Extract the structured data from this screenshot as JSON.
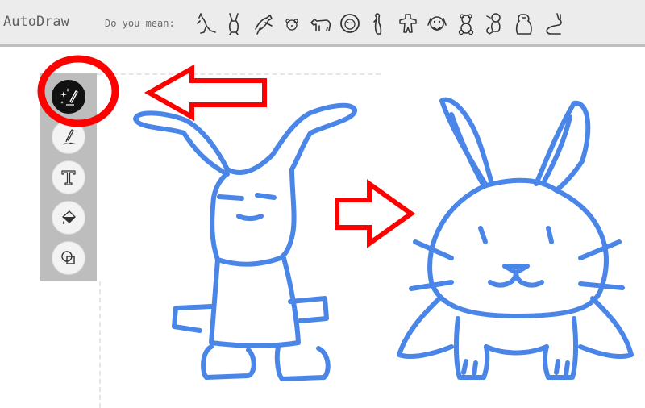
{
  "app": {
    "title": "AutoDraw"
  },
  "suggestions": {
    "label": "Do you mean:",
    "items": [
      {
        "icon": "kangaroo-icon"
      },
      {
        "icon": "rabbit-icon"
      },
      {
        "icon": "kangaroo-jumping-icon"
      },
      {
        "icon": "bear-face-icon"
      },
      {
        "icon": "bear-walking-icon"
      },
      {
        "icon": "lion-face-icon"
      },
      {
        "icon": "meerkat-icon"
      },
      {
        "icon": "gingerbread-icon"
      },
      {
        "icon": "dog-face-icon"
      },
      {
        "icon": "teddy-bear-icon"
      },
      {
        "icon": "monkey-icon"
      },
      {
        "icon": "gorilla-icon"
      },
      {
        "icon": "rabbit-sitting-icon"
      }
    ]
  },
  "toolbar": {
    "tools": [
      {
        "name": "autodraw-tool",
        "icon": "magic-pen-icon",
        "active": true
      },
      {
        "name": "draw-tool",
        "icon": "pencil-icon",
        "active": false
      },
      {
        "name": "type-tool",
        "icon": "text-icon",
        "active": false
      },
      {
        "name": "fill-tool",
        "icon": "paint-bucket-icon",
        "active": false
      },
      {
        "name": "shape-tool",
        "icon": "shapes-icon",
        "active": false
      }
    ]
  },
  "colors": {
    "stroke": "#4a86e8",
    "annotation": "#ff0000",
    "toolbar": "#bdbdbd",
    "topbar": "#ececec"
  }
}
